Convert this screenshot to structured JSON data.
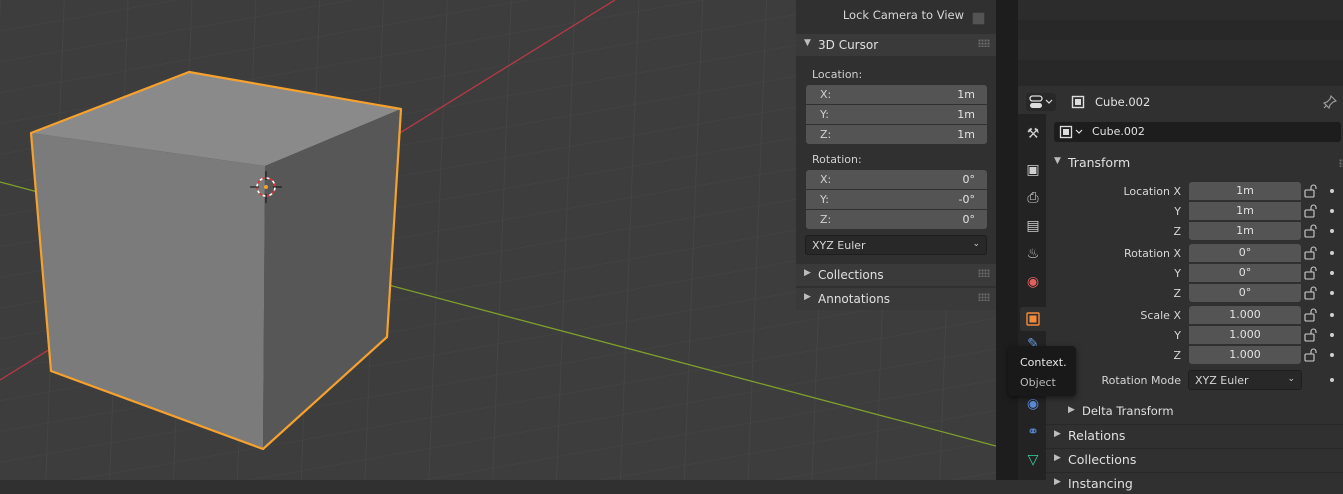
{
  "npanel": {
    "lock_camera_label": "Lock Camera to View",
    "cursor_title": "3D Cursor",
    "location_label": "Location:",
    "location": [
      {
        "axis": "X:",
        "value": "1m"
      },
      {
        "axis": "Y:",
        "value": "1m"
      },
      {
        "axis": "Z:",
        "value": "1m"
      }
    ],
    "rotation_label": "Rotation:",
    "rotation": [
      {
        "axis": "X:",
        "value": "0°"
      },
      {
        "axis": "Y:",
        "value": "-0°"
      },
      {
        "axis": "Z:",
        "value": "0°"
      }
    ],
    "rotation_mode": "XYZ Euler",
    "collections_title": "Collections",
    "annotations_title": "Annotations"
  },
  "properties": {
    "header_object": "Cube.002",
    "name_value": "Cube.002",
    "transform_title": "Transform",
    "location_x_label": "Location X",
    "y_label": "Y",
    "z_label": "Z",
    "location": [
      "1m",
      "1m",
      "1m"
    ],
    "rotation_x_label": "Rotation X",
    "rotation": [
      "0°",
      "0°",
      "0°"
    ],
    "scale_x_label": "Scale X",
    "scale": [
      "1.000",
      "1.000",
      "1.000"
    ],
    "rotation_mode_label": "Rotation Mode",
    "rotation_mode_value": "XYZ Euler",
    "delta_title": "Delta Transform",
    "relations_title": "Relations",
    "collections_title": "Collections",
    "instancing_title": "Instancing"
  },
  "tooltip": {
    "line1": "Context.",
    "line2": "Object"
  },
  "colors": {
    "selection_outline": "#f5a12f",
    "x_axis": "#b83a46",
    "y_axis": "#7e9f2b",
    "object_tab_accent": "#f28b3a"
  }
}
